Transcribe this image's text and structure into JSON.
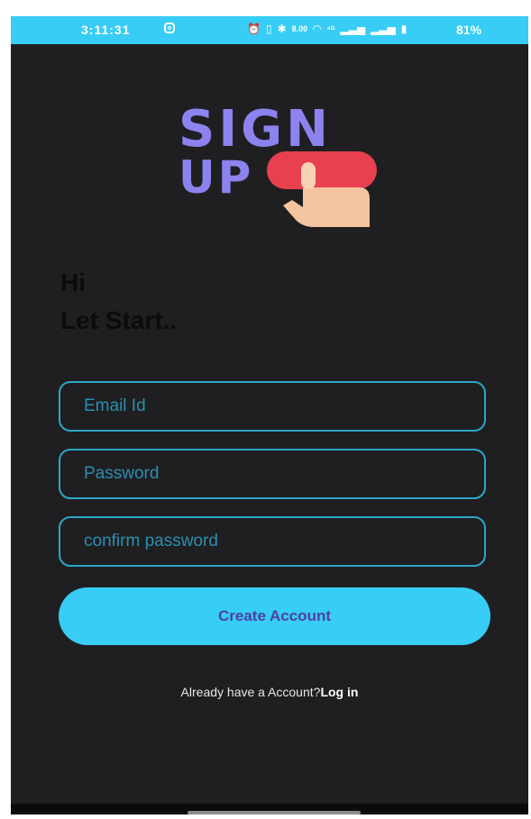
{
  "status_bar": {
    "time": "3:11:31",
    "icons": [
      "alarm-icon",
      "vibrate-icon",
      "bluetooth-icon",
      "data-speed-icon",
      "wifi-icon",
      "volte-icon",
      "signal-icon",
      "signal-icon",
      "battery-icon"
    ],
    "data_speed": "8.00",
    "battery": "81%"
  },
  "logo": {
    "line1": "SIGN",
    "line2": "UP"
  },
  "greeting": {
    "line1": "Hi",
    "line2": "Let Start.."
  },
  "form": {
    "email_placeholder": "Email Id",
    "password_placeholder": "Password",
    "confirm_placeholder": "confirm password",
    "create_label": "Create Account"
  },
  "footer": {
    "prompt": "Already have a Account?",
    "login_label": "Log in"
  },
  "colors": {
    "status_bar": "#38cdf5",
    "background": "#1f1f21",
    "accent": "#37cdf5",
    "field_border": "#2aa7c7",
    "logo_purple": "#8c83ee",
    "logo_red": "#e8404e"
  }
}
